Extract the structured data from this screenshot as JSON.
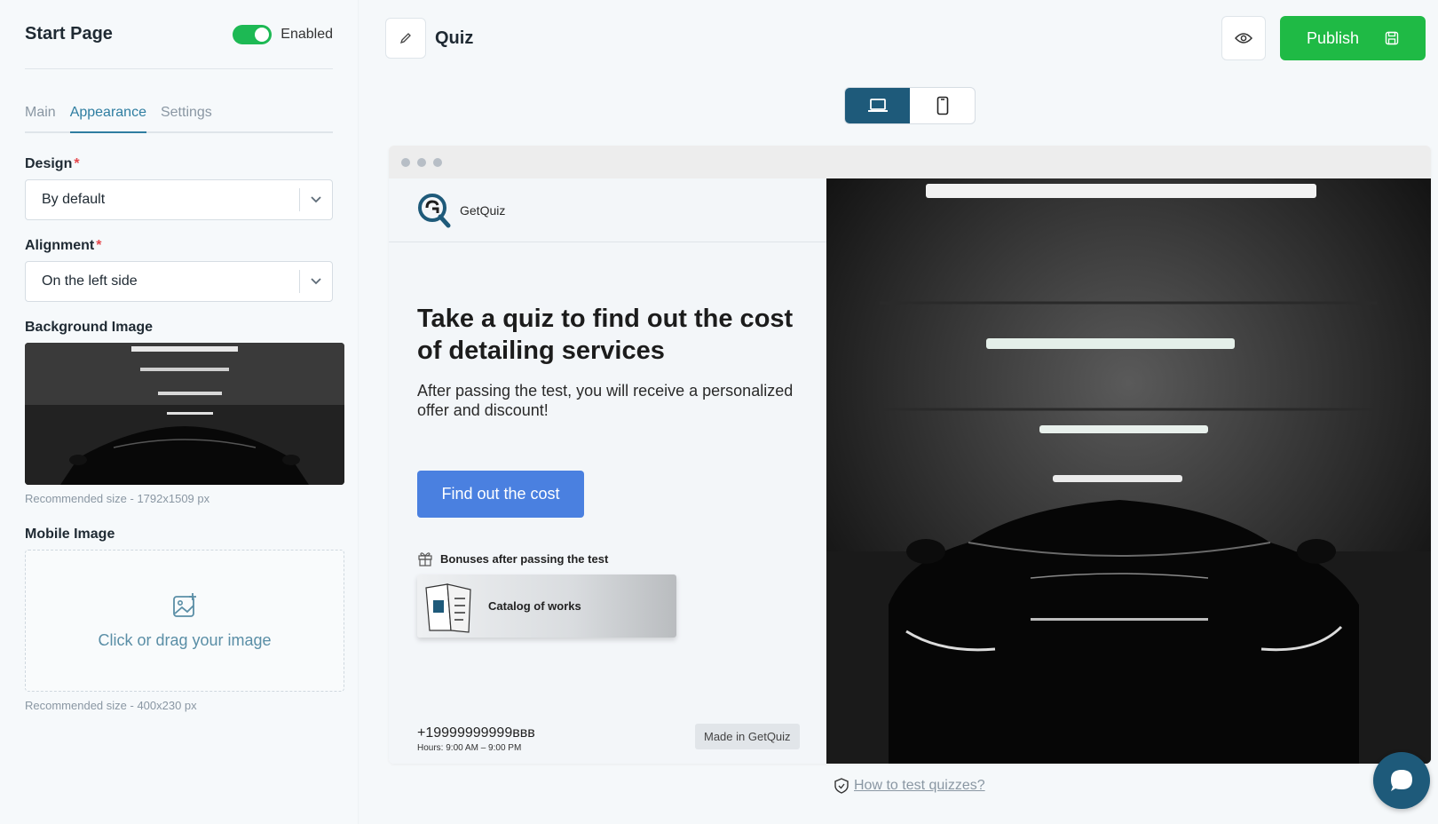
{
  "sidebar": {
    "title": "Start Page",
    "toggle_label": "Enabled",
    "tabs": [
      {
        "label": "Main",
        "active": false
      },
      {
        "label": "Appearance",
        "active": true
      },
      {
        "label": "Settings",
        "active": false
      }
    ],
    "design": {
      "label": "Design",
      "required_mark": "*",
      "value": "By default"
    },
    "alignment": {
      "label": "Alignment",
      "required_mark": "*",
      "value": "On the left side"
    },
    "background_image": {
      "label": "Background Image",
      "hint": "Recommended size - 1792x1509 px"
    },
    "mobile_image": {
      "label": "Mobile Image",
      "dropzone_text": "Click or drag your image",
      "hint": "Recommended size - 400x230 px"
    }
  },
  "topbar": {
    "quiz_title": "Quiz",
    "publish_label": "Publish"
  },
  "preview": {
    "brand": "GetQuiz",
    "title": "Take a quiz to find out the cost of detailing services",
    "subtitle": "After passing the test, you will receive a personalized offer and discount!",
    "cta": "Find out the cost",
    "bonus_heading": "Bonuses after passing the test",
    "bonus_item": "Catalog of works",
    "phone": "+19999999999ввв",
    "hours": "Hours: 9:00 AM – 9:00 PM",
    "made_in": "Made in GetQuiz"
  },
  "help_link": "How to test quizzes?",
  "colors": {
    "accent": "#2f7ea1",
    "publish": "#1fba45",
    "cta": "#4a80e0",
    "toggle": "#1db954",
    "dark_device": "#1e5a7a"
  }
}
